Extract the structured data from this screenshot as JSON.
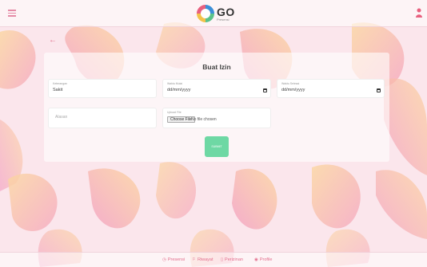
{
  "header": {
    "menu_icon": "hamburger-icon",
    "logo_main": "GO",
    "logo_sub": "Presensi",
    "user_icon": "user-icon"
  },
  "back_icon": "back-arrow-icon",
  "form": {
    "title": "Buat Izin",
    "keterangan": {
      "label": "Keterangan",
      "value": "Sakit"
    },
    "waktu_mulai": {
      "label": "Waktu Mulai",
      "value": "dd/mm/yyyy"
    },
    "waktu_selesai": {
      "label": "Waktu Selesai",
      "value": "dd/mm/yyyy"
    },
    "alasan": {
      "placeholder": "Alasan"
    },
    "upload": {
      "label": "Upload File",
      "button": "Choose File",
      "status": "No file chosen"
    },
    "submit_label": "SUBMIT"
  },
  "bottom_nav": [
    {
      "icon": "clock-icon",
      "label": "Presensi"
    },
    {
      "icon": "history-icon",
      "label": "Riwayat"
    },
    {
      "icon": "document-icon",
      "label": "Perizinan"
    },
    {
      "icon": "profile-icon",
      "label": "Profile"
    }
  ],
  "colors": {
    "accent": "#e26d8c",
    "submit": "#6ed8a4",
    "background": "#fbe6ec"
  }
}
